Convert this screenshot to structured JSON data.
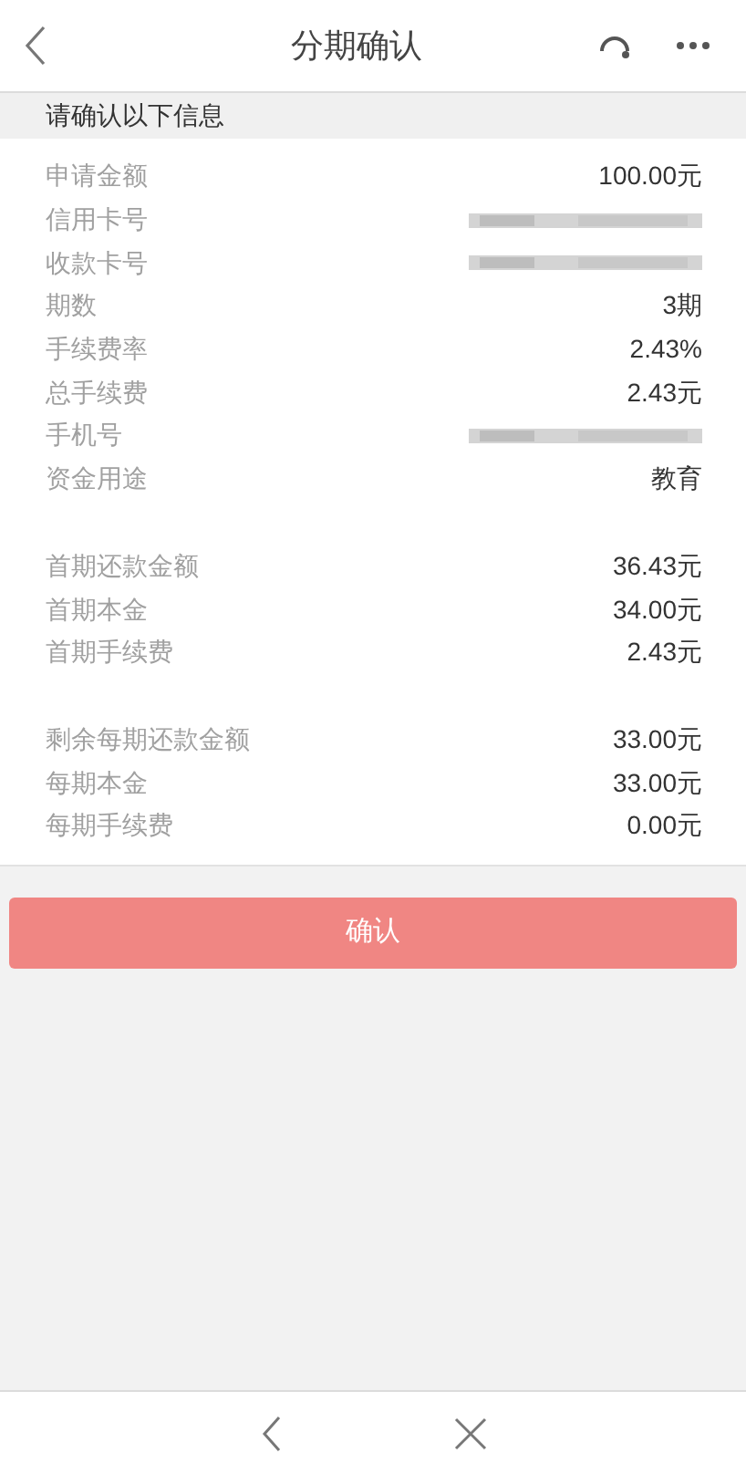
{
  "header": {
    "title": "分期确认"
  },
  "section": {
    "title": "请确认以下信息"
  },
  "groups": [
    {
      "rows": [
        {
          "kind": "text",
          "label": "申请金额",
          "value": "100.00元"
        },
        {
          "kind": "masked",
          "label": "信用卡号"
        },
        {
          "kind": "masked",
          "label": "收款卡号"
        },
        {
          "kind": "text",
          "label": "期数",
          "value": "3期"
        },
        {
          "kind": "text",
          "label": "手续费率",
          "value": "2.43%"
        },
        {
          "kind": "text",
          "label": "总手续费",
          "value": "2.43元"
        },
        {
          "kind": "masked",
          "label": "手机号"
        },
        {
          "kind": "text",
          "label": "资金用途",
          "value": "教育"
        }
      ]
    },
    {
      "rows": [
        {
          "kind": "text",
          "label": "首期还款金额",
          "value": "36.43元"
        },
        {
          "kind": "text",
          "label": "首期本金",
          "value": "34.00元"
        },
        {
          "kind": "text",
          "label": "首期手续费",
          "value": "2.43元"
        }
      ]
    },
    {
      "rows": [
        {
          "kind": "text",
          "label": "剩余每期还款金额",
          "value": "33.00元"
        },
        {
          "kind": "text",
          "label": "每期本金",
          "value": "33.00元"
        },
        {
          "kind": "text",
          "label": "每期手续费",
          "value": "0.00元"
        }
      ]
    }
  ],
  "confirm_button": {
    "label": "确认"
  }
}
